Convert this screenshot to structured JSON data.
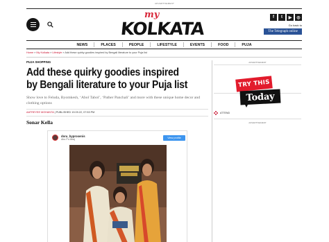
{
  "ads": {
    "top_label": "ADVERTISEMENT",
    "right_label": "ADVERTISEMENT",
    "right_label_2": "ADVERTISEMENT"
  },
  "header": {
    "logo_my": "my",
    "logo_city": "KOLKATA",
    "go_back": "Go back to",
    "telegraph_label": "The Telegraph online",
    "social": [
      "f",
      "t",
      "▶",
      "◎"
    ]
  },
  "nav": {
    "items": [
      "NEWS",
      "PLACES",
      "PEOPLE",
      "LIFESTYLE",
      "EVENTS",
      "FOOD",
      "PUJA"
    ]
  },
  "breadcrumb": {
    "home": "Home",
    "sep1": " » ",
    "level1": "My Kolkata",
    "sep2": " » ",
    "level2": "Lifestyle",
    "sep3": " » ",
    "current": "Add these quirky goodies inspired by Bengali literature to your Puja list"
  },
  "article": {
    "category": "PUJA SHOPPING",
    "headline": "Add these quirky goodies inspired by Bengali literature to your Puja list",
    "subhead": "Show love to Feluda, Byomkesh, ‘Abol Tabol’, ‘Pather Panchali’ and more with these unique home decor and clothing options",
    "author": "AATREYEE MOHANTA",
    "published": " | PUBLISHED 19.09.22, 07:53 PM",
    "section_title": "Sonar Kella"
  },
  "instagram": {
    "username": "dora_byprosenis",
    "subtitle": "Abu Pu Abaj",
    "button": "View profile"
  },
  "promo": {
    "line1": "TRY THIS",
    "line2": "Today"
  },
  "sidebar": {
    "brand_text": "ATTEND"
  },
  "colors": {
    "accent_red": "#c8102e",
    "telegraph_blue": "#2a5296",
    "instagram_blue": "#3d95ef"
  }
}
